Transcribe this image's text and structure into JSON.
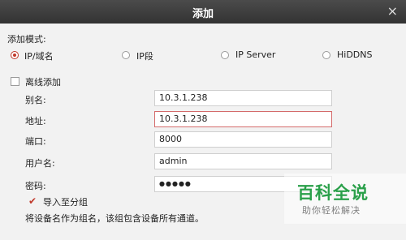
{
  "dialog": {
    "title": "添加",
    "close_glyph": "×"
  },
  "mode": {
    "label": "添加模式:",
    "options": [
      {
        "label": "IP/域名",
        "selected": true
      },
      {
        "label": "IP段",
        "selected": false
      },
      {
        "label": "IP Server",
        "selected": false
      },
      {
        "label": "HiDDNS",
        "selected": false
      }
    ]
  },
  "offline": {
    "label": "离线添加",
    "checked": false
  },
  "form": {
    "alias": {
      "label": "别名:",
      "value": "10.3.1.238"
    },
    "address": {
      "label": "地址:",
      "value": "10.3.1.238"
    },
    "port": {
      "label": "端口:",
      "value": "8000"
    },
    "username": {
      "label": "用户名:",
      "value": "admin"
    },
    "password": {
      "label": "密码:",
      "value": "●●●●●"
    }
  },
  "import_group": {
    "label": "导入至分组",
    "checked": true,
    "check_glyph": "✔"
  },
  "hint": "将设备名作为组名，该组包含设备所有通道。",
  "watermark": {
    "logo": "百科全说",
    "sub": "助你轻松解决"
  },
  "colors": {
    "accent": "#c0392b",
    "titlebar": "#3d3d3d",
    "watermark_green": "#2aa04a"
  }
}
